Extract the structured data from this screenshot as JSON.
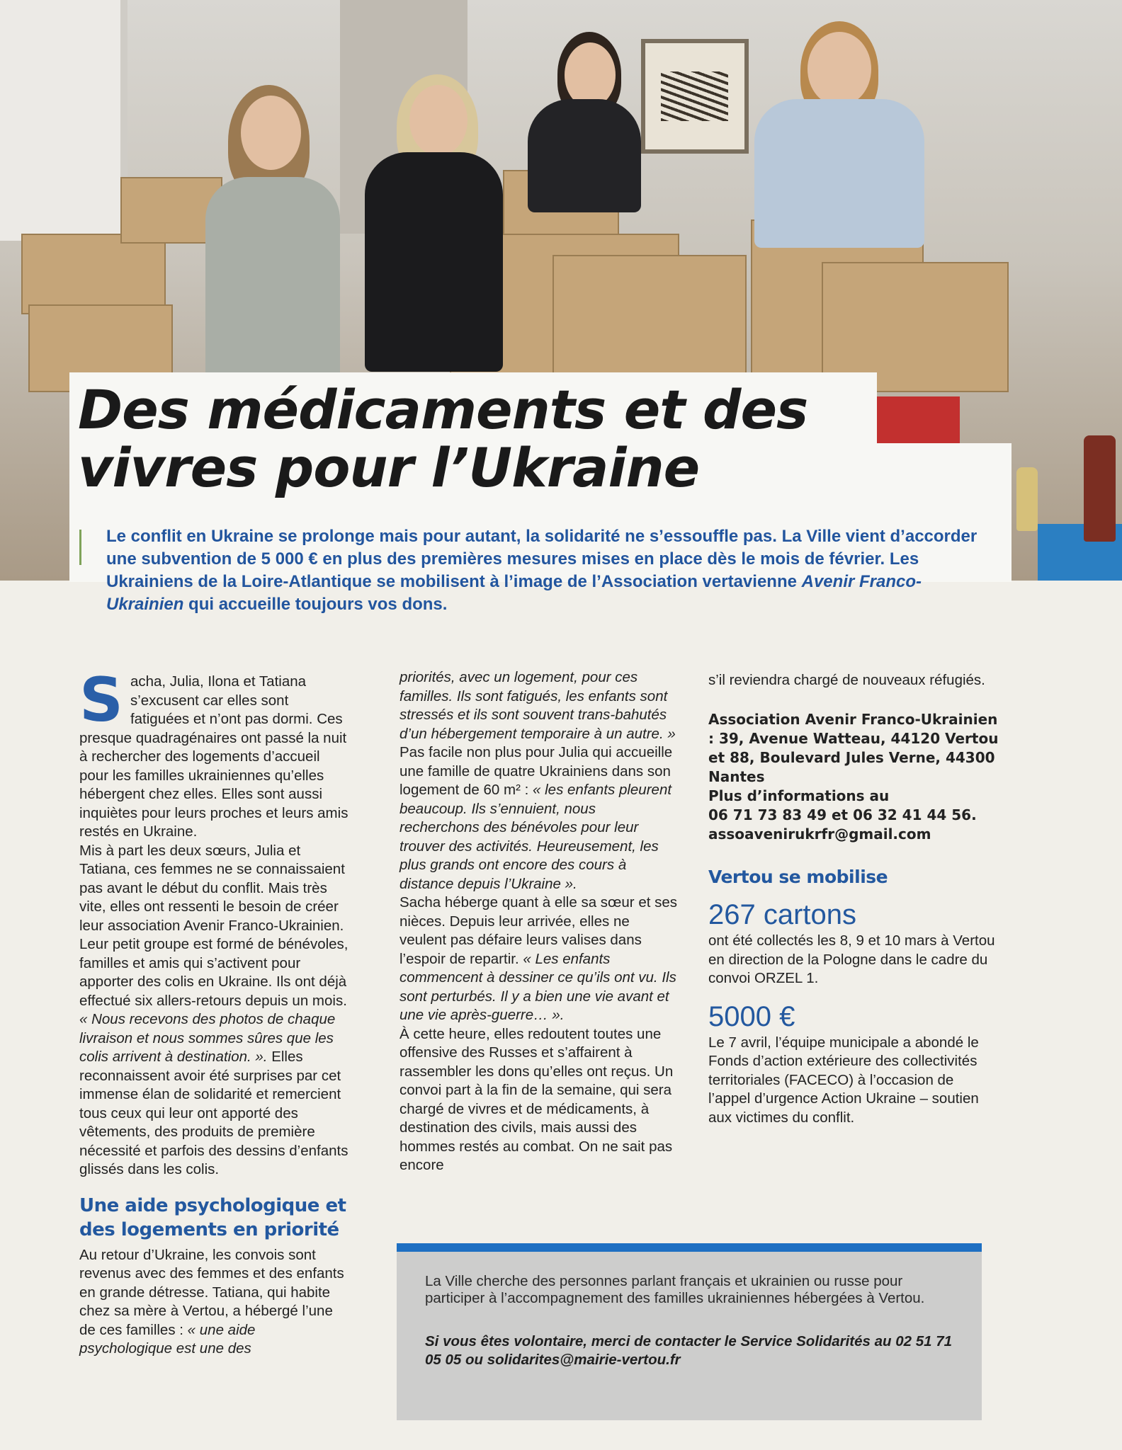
{
  "article": {
    "title": "Des médicaments et des vivres pour l’Ukraine",
    "lede_before": "Le conflit en Ukraine se prolonge mais pour autant, la solidarité ne s’essouffle pas. La Ville vient d’accorder une subvention de 5 000 € en plus des premières mesures mises en place dès le mois de février. Les Ukrainiens de la Loire-Atlantique se mobilisent à l’image de l’Association vertavienne ",
    "lede_em": "Avenir Franco-Ukrainien",
    "lede_after": " qui accueille toujours vos dons."
  },
  "col1": {
    "dropcap": "S",
    "p1": "acha, Julia, Ilona et Tatiana s’excusent car elles sont fatiguées et n’ont pas dormi. Ces presque quadragénaires ont passé la nuit à rechercher des logements d’accueil pour les familles ukrainiennes qu’elles hébergent chez elles. Elles sont aussi inquiètes pour leurs proches et leurs amis restés en Ukraine.",
    "p2_before": "Mis à part les deux sœurs, Julia et Tatiana, ces femmes ne se connaissaient pas avant le début du conflit. Mais très vite, elles ont ressenti le besoin de créer leur association Avenir Franco-Ukrainien. Leur petit groupe est formé de bénévoles, familles et amis qui s’activent pour apporter des colis en Ukraine. Ils ont déjà effectué six allers-retours depuis un mois. ",
    "p2_em": "« Nous recevons des photos de chaque livraison et nous sommes sûres que les colis arrivent à destination. ».",
    "p2_after": " Elles reconnaissent avoir été surprises par cet immense élan de solidarité et remercient tous ceux qui leur ont apporté des vêtements, des produits de première nécessité et parfois des dessins d’enfants glissés dans les colis.",
    "subhead": "Une aide psychologique et des logements en priorité",
    "p3_before": "Au retour d’Ukraine, les convois sont revenus avec des femmes et des enfants en grande détresse. Tatiana, qui habite chez sa mère à Vertou, a hébergé l’une de ces familles : ",
    "p3_em": "« une aide psychologique est une des"
  },
  "col2": {
    "p1_em": "priorités, avec un logement, pour ces familles. Ils sont fatigués, les enfants sont stressés et ils sont souvent trans-bahutés d’un hébergement temporaire à un autre. »",
    "p2_before": "Pas facile non plus pour Julia qui accueille une famille de quatre Ukrainiens dans son logement de 60 m² : ",
    "p2_em": "« les enfants pleurent beaucoup. Ils s’ennuient, nous recherchons des bénévoles pour leur trouver des activités. Heureusement, les plus grands ont encore des cours à distance depuis l’Ukraine ».",
    "p3_before": "Sacha héberge quant à elle sa sœur et ses nièces. Depuis leur arrivée, elles ne veulent pas défaire leurs valises dans l’espoir de repartir. ",
    "p3_em": "« Les enfants commencent à dessiner ce qu’ils ont vu. Ils sont perturbés. Il y a bien une vie avant et une vie après-guerre… ».",
    "p4": "À cette heure, elles redoutent toutes une offensive des Russes et s’affairent à rassembler les dons qu’elles ont reçus. Un convoi part à la fin de la semaine, qui sera chargé de vivres et de médicaments, à destination des civils, mais aussi des hommes restés au combat. On ne sait pas encore"
  },
  "col3": {
    "p1": "s’il reviendra chargé de nouveaux réfugiés.",
    "address": "Association Avenir Franco-Ukrainien : 39, Avenue Watteau, 44120 Vertou et 88, Boulevard Jules Verne, 44300 Nantes",
    "info_label": "Plus d’informations au",
    "phones": "06 71 73 83 49 et 06 32 41 44 56.",
    "email": "assoavenirukrfr@gmail.com",
    "sidebar_title": "Vertou se mobilise",
    "stat1_value": "267 cartons",
    "stat1_text": "ont été collectés les 8, 9 et 10 mars à Vertou en direction de la Pologne dans le cadre du convoi ORZEL 1.",
    "stat2_value": "5000 €",
    "stat2_text": "Le 7 avril, l’équipe municipale a abondé le Fonds d’action extérieure des collectivités territoriales (FACECO) à l’occasion de l’appel d’urgence Action Ukraine – soutien aux victimes du conflit."
  },
  "info_box": {
    "text": "La Ville cherche des personnes parlant français et ukrainien ou russe pour participer à l’accompagnement des familles ukrainiennes hébergées à Vertou.",
    "call": "Si vous êtes volontaire, merci de contacter le Service Solidarités au 02 51 71 05 05 ou solidarites@mairie-vertou.fr"
  },
  "colors": {
    "accent_blue": "#23589f",
    "box_rule_blue": "#1e6fc2",
    "box_grey": "#cdcdcc"
  }
}
